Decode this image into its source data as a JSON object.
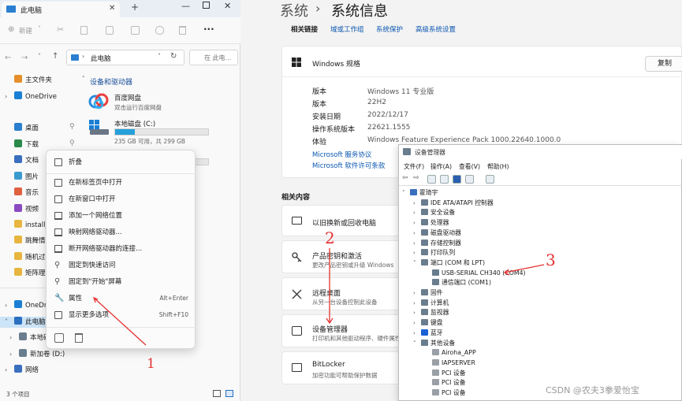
{
  "explorer": {
    "tab_title": "此电脑",
    "new_label": "新建",
    "address": "此电脑",
    "search_placeholder": "在 此电...",
    "nav": [
      {
        "label": "主文件夹",
        "color": "#e58f2a"
      },
      {
        "label": "OneDrive",
        "color": "#1a7fd4"
      },
      {
        "label": "桌面",
        "color": "#2a7fd0"
      },
      {
        "label": "下载",
        "color": "#2a8a4a"
      },
      {
        "label": "文档",
        "color": "#3a6fc0"
      },
      {
        "label": "图片",
        "color": "#3a9ad0"
      },
      {
        "label": "音乐",
        "color": "#e06040"
      },
      {
        "label": "视频",
        "color": "#8a4ac0"
      },
      {
        "label": "install_",
        "color": "#e8b640"
      },
      {
        "label": "跳舞情",
        "color": "#e8b640"
      },
      {
        "label": "随机过程",
        "color": "#e8b640"
      },
      {
        "label": "矩阵理论",
        "color": "#e8b640"
      },
      {
        "label": "OneDri",
        "color": "#1a7fd4"
      },
      {
        "label": "此电脑",
        "color": "#2a6fc0"
      },
      {
        "label": "本地磁",
        "color": "#6a7d8e"
      },
      {
        "label": "新加卷 (D:)",
        "color": "#6a7d8e"
      },
      {
        "label": "网络",
        "color": "#3a6fc0"
      }
    ],
    "section_title": "设备和驱动器",
    "drives": [
      {
        "name": "百度网盘",
        "sub": "双击运行百度网盘"
      },
      {
        "name": "本地磁盘 (C:)",
        "sub": "235 GB 可用，共 299 GB",
        "used_fraction": 0.21
      }
    ],
    "status": "3 个项目"
  },
  "context_menu": {
    "items": [
      {
        "label": "折叠",
        "shortcut": ""
      },
      {
        "label": "在新标签页中打开",
        "shortcut": ""
      },
      {
        "label": "在新窗口中打开",
        "shortcut": ""
      },
      {
        "label": "添加一个网络位置",
        "shortcut": ""
      },
      {
        "label": "映射网络驱动器...",
        "shortcut": ""
      },
      {
        "label": "断开网络驱动器的连接...",
        "shortcut": ""
      },
      {
        "label": "固定到快速访问",
        "shortcut": ""
      },
      {
        "label": "固定到\"开始\"屏幕",
        "shortcut": ""
      },
      {
        "label": "属性",
        "shortcut": "Alt+Enter"
      },
      {
        "label": "显示更多选项",
        "shortcut": "Shift+F10"
      }
    ]
  },
  "settings": {
    "breadcrumb_parent": "系统",
    "breadcrumb_sep": "›",
    "page_title": "系统信息",
    "related_links_label": "相关链接",
    "related_links": [
      "域或工作组",
      "系统保护",
      "高级系统设置"
    ],
    "spec_title": "Windows 规格",
    "copy_label": "复制",
    "specs": [
      {
        "k": "版本",
        "v": "Windows 11 专业版"
      },
      {
        "k": "版本",
        "v": "22H2"
      },
      {
        "k": "安装日期",
        "v": "2022/12/17"
      },
      {
        "k": "操作系统版本",
        "v": "22621.1555"
      },
      {
        "k": "体验",
        "v": "Windows Feature Experience Pack 1000.22640.1000.0"
      }
    ],
    "service_link": "Microsoft 服务协议",
    "license_link": "Microsoft 软件许可条款",
    "related_content_label": "相关内容",
    "related": [
      {
        "title": "以旧换新或回收电脑",
        "sub": ""
      },
      {
        "title": "产品密钥和激活",
        "sub": "更改产品密钥或升级 Windows"
      },
      {
        "title": "远程桌面",
        "sub": "从另一台设备控制此设备"
      },
      {
        "title": "设备管理器",
        "sub": "打印机和其他驱动程序、硬件属性"
      },
      {
        "title": "BitLocker",
        "sub": "加密功能可帮助保护数据"
      }
    ]
  },
  "device_manager": {
    "title": "设备管理器",
    "menu": [
      "文件(F)",
      "操作(A)",
      "查看(V)",
      "帮助(H)"
    ],
    "tree": [
      {
        "label": "霍琦宇",
        "level": 0,
        "arrow": "v"
      },
      {
        "label": "IDE ATA/ATAPI 控制器",
        "level": 1,
        "arrow": ">"
      },
      {
        "label": "安全设备",
        "level": 1,
        "arrow": ">"
      },
      {
        "label": "处理器",
        "level": 1,
        "arrow": ">"
      },
      {
        "label": "磁盘驱动器",
        "level": 1,
        "arrow": ">"
      },
      {
        "label": "存储控制器",
        "level": 1,
        "arrow": ">"
      },
      {
        "label": "打印队列",
        "level": 1,
        "arrow": ">"
      },
      {
        "label": "端口 (COM 和 LPT)",
        "level": 1,
        "arrow": "v"
      },
      {
        "label": "USB-SERIAL CH340 (COM4)",
        "level": 2,
        "arrow": ""
      },
      {
        "label": "通信端口 (COM1)",
        "level": 2,
        "arrow": ""
      },
      {
        "label": "固件",
        "level": 1,
        "arrow": ">"
      },
      {
        "label": "计算机",
        "level": 1,
        "arrow": ">"
      },
      {
        "label": "监视器",
        "level": 1,
        "arrow": ">"
      },
      {
        "label": "键盘",
        "level": 1,
        "arrow": ">"
      },
      {
        "label": "蓝牙",
        "level": 1,
        "arrow": ">"
      },
      {
        "label": "其他设备",
        "level": 1,
        "arrow": "v"
      },
      {
        "label": "Airoha_APP",
        "level": 2,
        "arrow": ""
      },
      {
        "label": "IAPSERVER",
        "level": 2,
        "arrow": ""
      },
      {
        "label": "PCI 设备",
        "level": 2,
        "arrow": ""
      },
      {
        "label": "PCI 设备",
        "level": 2,
        "arrow": ""
      },
      {
        "label": "PCI 设备",
        "level": 2,
        "arrow": ""
      }
    ]
  },
  "annotations": {
    "a1": "1",
    "a2": "2",
    "a3": "3",
    "color": "#e53030"
  },
  "watermark": "CSDN @农夫3拳爱怡宝"
}
